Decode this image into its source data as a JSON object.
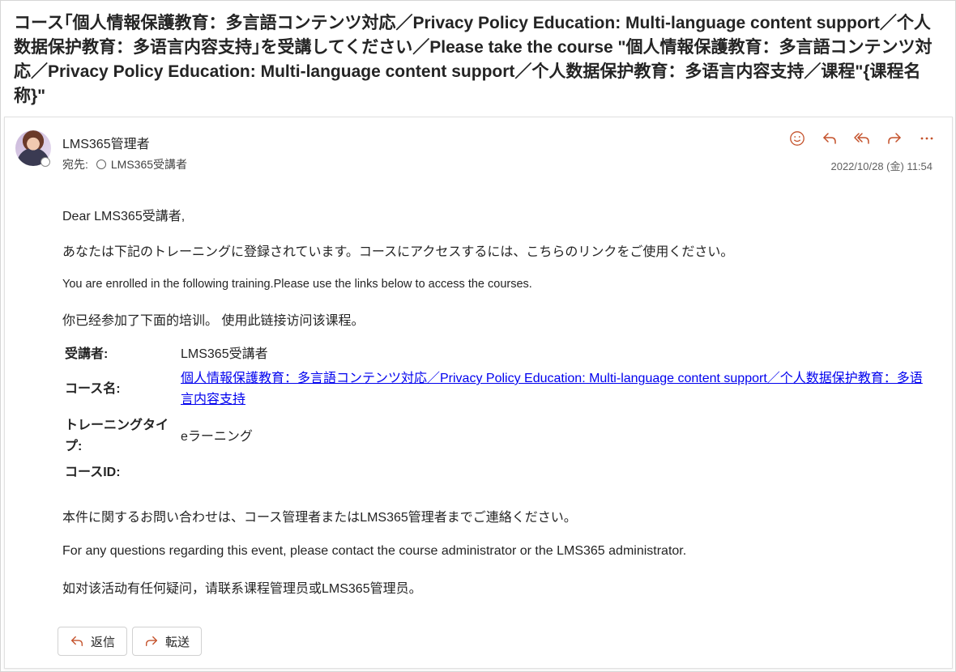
{
  "subject": "コース｢個人情報保護教育：多言語コンテンツ対応／Privacy Policy Education: Multi-language content support／个人数据保护教育：多语言内容支持｣を受講してください／Please take the course \"個人情報保護教育：多言語コンテンツ対応／Privacy Policy Education: Multi-language content support／个人数据保护教育：多语言内容支持／课程\"{课程名称}\"",
  "message": {
    "sender": "LMS365管理者",
    "to_label": "宛先:",
    "to_recipient": "LMS365受講者",
    "date": "2022/10/28 (金) 11:54",
    "actions": [
      "smile-icon",
      "reply-icon",
      "reply-all-icon",
      "forward-icon",
      "more-icon"
    ]
  },
  "body": {
    "greeting": "Dear LMS365受講者,",
    "intro_ja": "あなたは下記のトレーニングに登録されています。コースにアクセスするには、こちらのリンクをご使用ください。",
    "intro_en": "You are enrolled in the following training.Please use the links below to access the courses.",
    "intro_zh": "你已经参加了下面的培训。 使用此链接访问该课程。",
    "table": {
      "learner_label": "受講者:",
      "learner_value": "LMS365受講者",
      "course_label": "コース名:",
      "course_value": "個人情報保護教育：多言語コンテンツ対応／Privacy Policy Education: Multi-language content support／个人数据保护教育：多语言内容支持",
      "type_label": "トレーニングタイプ:",
      "type_value": "eラーニング",
      "id_label": "コースID:",
      "id_value": ""
    },
    "contact_ja": "本件に関するお問い合わせは、コース管理者またはLMS365管理者までご連絡ください。",
    "contact_en": "For any questions regarding this event, please contact the course administrator or the LMS365 administrator.",
    "contact_zh": "如对该活动有任何疑问，请联系课程管理员或LMS365管理员。"
  },
  "footer": {
    "reply_label": "返信",
    "forward_label": "転送"
  },
  "colors": {
    "action_icon": "#c4512a",
    "link": "#0000ee"
  }
}
